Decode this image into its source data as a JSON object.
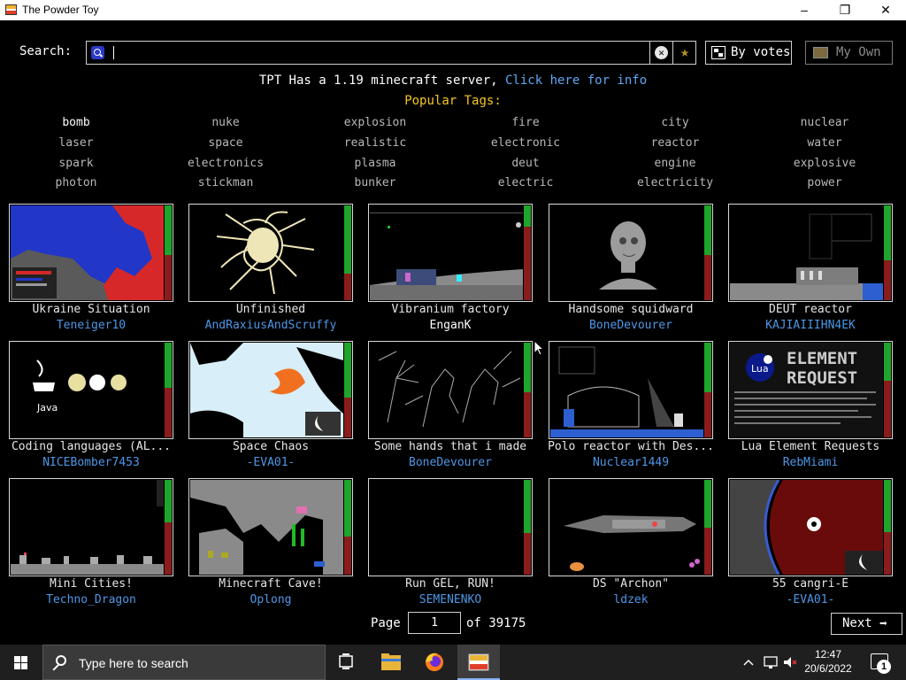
{
  "window": {
    "title": "The Powder Toy",
    "minimize_glyph": "–",
    "maximize_glyph": "❐",
    "close_glyph": "✕"
  },
  "search": {
    "label": "Search:",
    "value": "",
    "placeholder": ""
  },
  "sort_button": {
    "label": "By votes"
  },
  "own_button": {
    "label": "My Own"
  },
  "motd": {
    "text": "TPT Has a 1.19 minecraft server, ",
    "link": "Click here for info"
  },
  "popular_tags_title": "Popular Tags:",
  "tags": [
    [
      "bomb",
      "nuke",
      "explosion",
      "fire",
      "city",
      "nuclear"
    ],
    [
      "laser",
      "space",
      "realistic",
      "electronic",
      "reactor",
      "water"
    ],
    [
      "spark",
      "electronics",
      "plasma",
      "deut",
      "engine",
      "explosive"
    ],
    [
      "photon",
      "stickman",
      "bunker",
      "electric",
      "electricity",
      "power"
    ]
  ],
  "saves": [
    {
      "title": "Ukraine Situation",
      "author": "Teneiger10",
      "upvote_fraction": 0.52,
      "thumb": "ukraine"
    },
    {
      "title": "Unfinished",
      "author": "AndRaxiusAndScruffy",
      "upvote_fraction": 0.72,
      "thumb": "unfinished"
    },
    {
      "title": "Vibranium factory",
      "author": "EnganK",
      "upvote_fraction": 0.22,
      "thumb": "factory"
    },
    {
      "title": "Handsome squidward",
      "author": "BoneDevourer",
      "upvote_fraction": 0.52,
      "thumb": "squidward"
    },
    {
      "title": "DEUT reactor",
      "author": "KAJIAIIIHN4EK",
      "upvote_fraction": 0.58,
      "thumb": "reactor"
    },
    {
      "title": "Coding languages (AL...",
      "author": "NICEBomber7453",
      "upvote_fraction": 0.48,
      "thumb": "coding"
    },
    {
      "title": "Space Chaos",
      "author": "-EVA01-",
      "upvote_fraction": 0.58,
      "thumb": "space"
    },
    {
      "title": "Some hands that i made",
      "author": "BoneDevourer",
      "upvote_fraction": 0.52,
      "thumb": "hands"
    },
    {
      "title": "Polo reactor with Des...",
      "author": "Nuclear1449",
      "upvote_fraction": 0.52,
      "thumb": "polo"
    },
    {
      "title": "Lua Element Requests",
      "author": "RebMiami",
      "upvote_fraction": 0.4,
      "thumb": "lua"
    },
    {
      "title": "Mini Cities!",
      "author": "Techno_Dragon",
      "upvote_fraction": 0.45,
      "thumb": "cities"
    },
    {
      "title": "Minecraft Cave!",
      "author": "Oplong",
      "upvote_fraction": 0.6,
      "thumb": "cave"
    },
    {
      "title": "Run GEL, RUN!",
      "author": "SEMENENKO",
      "upvote_fraction": 0.56,
      "thumb": "blank"
    },
    {
      "title": "DS \"Archon\"",
      "author": "ldzek",
      "upvote_fraction": 0.5,
      "thumb": "ship"
    },
    {
      "title": "55 cangri-E",
      "author": "-EVA01-",
      "upvote_fraction": 0.55,
      "thumb": "planet"
    }
  ],
  "pagination": {
    "page_label": "Page",
    "current_page": "1",
    "of_label": "of 39175",
    "next_label": "Next"
  },
  "taskbar": {
    "search_placeholder": "Type here to search",
    "time": "12:47",
    "date": "20/6/2022",
    "notifications": "1"
  }
}
